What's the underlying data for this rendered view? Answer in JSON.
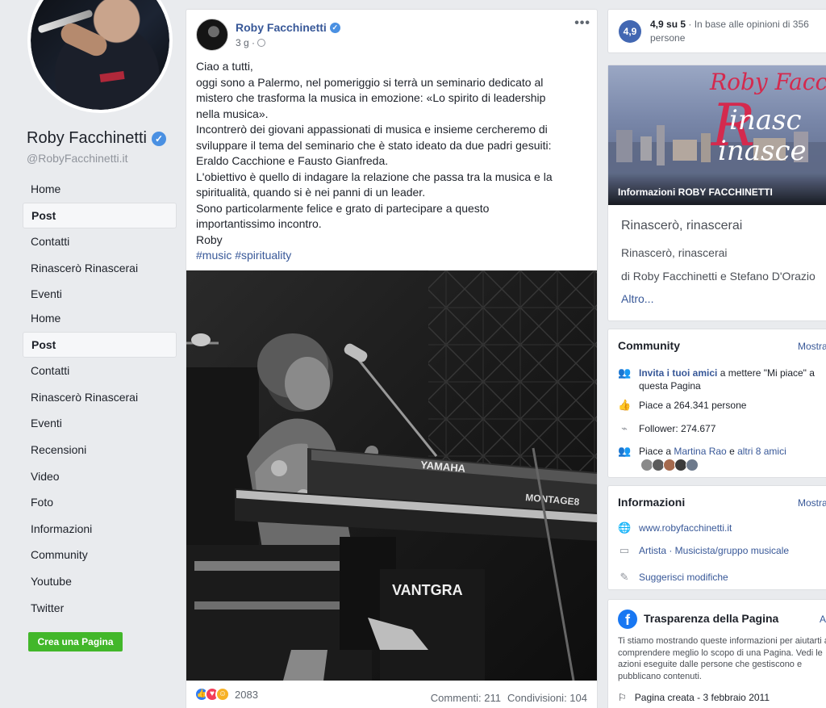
{
  "page": {
    "name": "Roby Facchinetti",
    "handle": "@RobyFacchinetti.it",
    "verified_glyph": "✓"
  },
  "nav_primary": [
    {
      "label": "Home"
    },
    {
      "label": "Post",
      "active": true
    },
    {
      "label": "Contatti"
    },
    {
      "label": "Rinascerò Rinascerai"
    },
    {
      "label": "Eventi"
    }
  ],
  "nav_secondary": [
    {
      "label": "Home"
    },
    {
      "label": "Post",
      "active": true
    },
    {
      "label": "Contatti"
    },
    {
      "label": "Rinascerò Rinascerai"
    },
    {
      "label": "Eventi"
    },
    {
      "label": "Recensioni"
    },
    {
      "label": "Video"
    },
    {
      "label": "Foto"
    },
    {
      "label": "Informazioni"
    },
    {
      "label": "Community"
    },
    {
      "label": "Youtube"
    },
    {
      "label": "Twitter"
    }
  ],
  "create_page_label": "Crea una Pagina",
  "post": {
    "author": "Roby Facchinetti",
    "time": "3 g ·",
    "more": "•••",
    "body": "Ciao a tutti,\noggi sono a Palermo, nel pomeriggio si terrà un seminario dedicato al\nmistero che trasforma la musica in emozione: «Lo spirito di leadership\nnella musica».\nIncontrerò dei giovani appassionati di musica e insieme cercheremo di\nsviluppare il tema del seminario che è stato ideato da due padri gesuiti:\nEraldo Cacchione e Fausto Gianfreda.\nL'obiettivo è quello di indagare la relazione che passa tra la musica e la\nspiritualità, quando si è nei panni di un leader.\nSono particolarmente felice e grato di partecipare a questo\nimportantissimo incontro.\nRoby",
    "hashtags": "#music #spirituality",
    "photo_texts": {
      "keyboard_brand": "YAMAHA",
      "keyboard_model": "MONTAGE8",
      "speaker_brand": "VANTGRA"
    },
    "reaction_count": "2083",
    "reaction_glyphs": {
      "like": "👍",
      "love": "♥",
      "care": "☺"
    },
    "comments": "Commenti: 211",
    "shares": "Condivisioni: 104"
  },
  "rating": {
    "score": "4,9",
    "headline": "4,9 su 5",
    "text": " · In base alle opinioni di 356 persone"
  },
  "about": {
    "cover_line1": "Roby Facch",
    "cover_line2": "inasc",
    "cover_line3": "inasce",
    "cover_bigR": "R",
    "cover_label": "Informazioni ROBY FACCHINETTI",
    "title": "Rinascerò, rinascerai",
    "subtitle": "Rinascerò, rinascerai",
    "desc": "di Roby Facchinetti e Stefano D'Orazio",
    "more": "Altro..."
  },
  "community": {
    "title": "Community",
    "link": "Mostra tutto",
    "invite_link": "Invita i tuoi amici",
    "invite_text": " a mettere \"Mi piace\" a questa Pagina",
    "likes": "Piace a 264.341 persone",
    "followers": "Follower: 274.677",
    "friends_prefix": "Piace a ",
    "friends_name": "Martina Rao",
    "friends_mid": " e ",
    "friends_others": "altri 8 amici"
  },
  "info": {
    "title": "Informazioni",
    "link": "Mostra tutto",
    "website": "www.robyfacchinetti.it",
    "category": "Artista · Musicista/gruppo musicale",
    "suggest": "Suggerisci modifiche"
  },
  "transparency": {
    "title": "Trasparenza della Pagina",
    "link": "Altro",
    "text": "Ti stiamo mostrando queste informazioni per aiutarti a comprendere meglio lo scopo di una Pagina. Vedi le azioni eseguite dalle persone che gestiscono e pubblicano contenuti.",
    "created": "Pagina creata - 3 febbraio 2011",
    "fb_glyph": "f"
  },
  "icons": {
    "invite": "👥",
    "like": "👍",
    "rss": "⌁",
    "friends": "👥",
    "globe": "🌐",
    "category": "▭",
    "pencil": "✎",
    "flag": "⚐"
  },
  "colors": {
    "link": "#385898",
    "accent": "#4267b2",
    "create": "#42b72a",
    "bg": "#e9ebee"
  }
}
